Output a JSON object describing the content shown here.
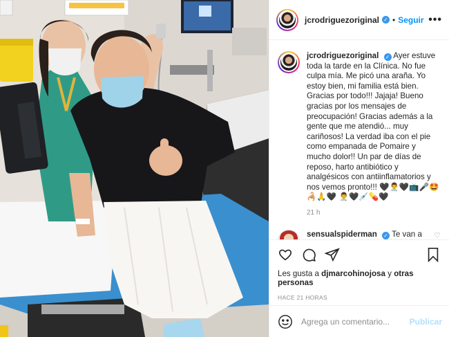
{
  "header": {
    "username": "jcrodriguezoriginal",
    "separator": "•",
    "follow_label": "Seguir",
    "more_label": "•••"
  },
  "caption": {
    "username": "jcrodriguezoriginal",
    "text": "Ayer estuve toda la tarde en la Clínica. No fue culpa mía. Me picó una araña. Yo estoy bien, mi familia está bien. Gracias por todo!!! Jajaja! Bueno gracias por los mensajes de preocupación! Gracias además a la gente que me atendió... muy cariñosos! La verdad iba con el pie como empanada de Pomaire y mucho dolor!! Un par de días de reposo, harto antibiótico y analgésicos con antiinflamatorios y nos vemos pronto!!! 🖤👨‍⚕️🖤📺🎤🤩🦂🙏🖤 👨‍⚕️🖤💉💊🖤",
    "time": "21 h"
  },
  "reply": {
    "username": "sensualspiderman",
    "text": "Te van a crecer las nalgas bro 🍑🍑🍑😂"
  },
  "likes": {
    "prefix": "Les gusta a ",
    "user": "djmarcohinojosa",
    "middle": " y ",
    "others": "otras personas"
  },
  "time_ago": "HACE 21 HORAS",
  "add_comment": {
    "placeholder": "Agrega un comentario...",
    "publish_label": "Publicar"
  },
  "icons": {
    "like": "heart-icon",
    "comment": "comment-icon",
    "share": "share-icon",
    "save": "bookmark-icon",
    "emoji": "emoji-icon"
  },
  "colors": {
    "accent": "#0095f6",
    "verified": "#3897f0",
    "muted": "#8e8e8e",
    "publish_disabled": "#b2dffc"
  }
}
